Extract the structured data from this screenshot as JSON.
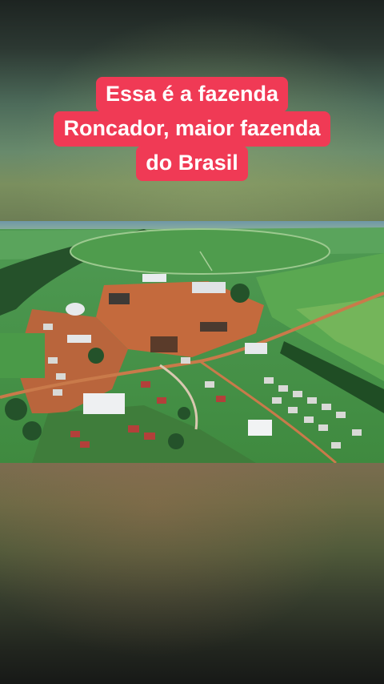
{
  "caption": {
    "lines": [
      "Essa é a fazenda",
      "Roncador, maior fazenda",
      "do Brasil"
    ]
  },
  "photo": {
    "subject": "aerial-farm-photo"
  },
  "colors": {
    "caption_bg": "#f03a55",
    "caption_text": "#ffffff"
  }
}
